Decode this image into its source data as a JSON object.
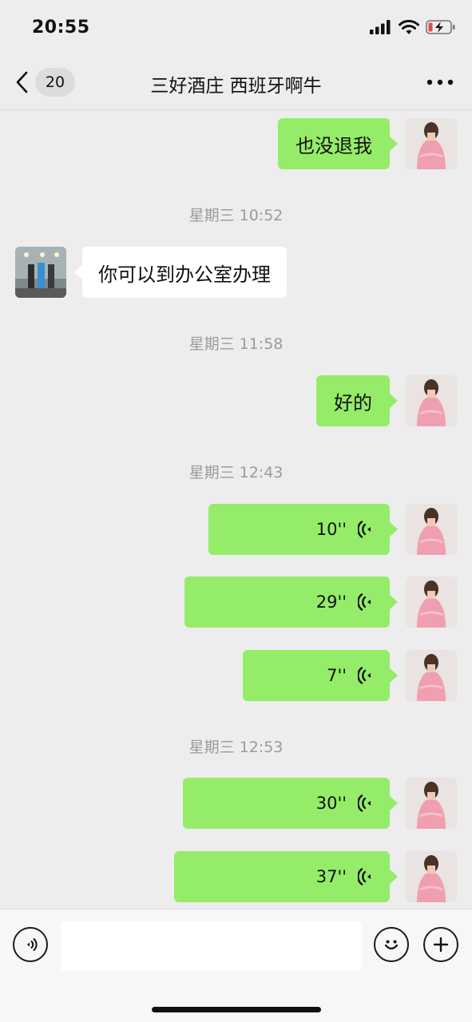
{
  "status_bar": {
    "time": "20:55"
  },
  "nav": {
    "unread_count": "20",
    "title": "三好酒庄  西班牙啊牛"
  },
  "messages": [
    {
      "type": "text",
      "direction": "out",
      "text": "也没退我"
    },
    {
      "type": "timestamp",
      "text": "星期三 10:52"
    },
    {
      "type": "text",
      "direction": "in",
      "text": "你可以到办公室办理"
    },
    {
      "type": "timestamp",
      "text": "星期三 11:58"
    },
    {
      "type": "text",
      "direction": "out",
      "text": "好的"
    },
    {
      "type": "timestamp",
      "text": "星期三 12:43"
    },
    {
      "type": "voice",
      "direction": "out",
      "duration": "10''"
    },
    {
      "type": "voice",
      "direction": "out",
      "duration": "29''"
    },
    {
      "type": "voice",
      "direction": "out",
      "duration": "7''"
    },
    {
      "type": "timestamp",
      "text": "星期三 12:53"
    },
    {
      "type": "voice",
      "direction": "out",
      "duration": "30''"
    },
    {
      "type": "voice",
      "direction": "out",
      "duration": "37''"
    }
  ],
  "input": {
    "value": "",
    "placeholder": ""
  },
  "colors": {
    "outgoing_bubble": "#95ec69",
    "incoming_bubble": "#ffffff",
    "background": "#ededed"
  }
}
